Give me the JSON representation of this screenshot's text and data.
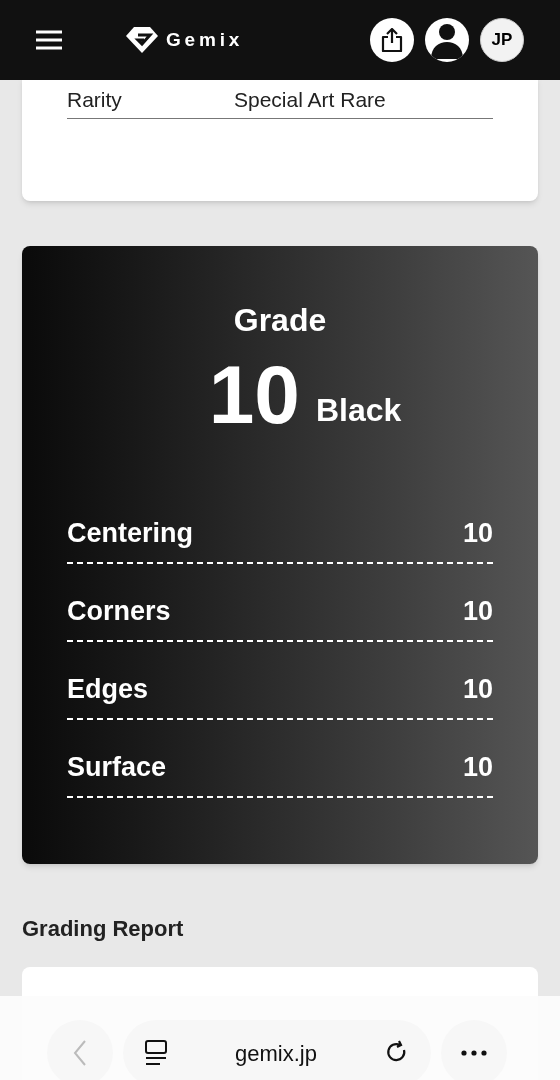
{
  "header": {
    "logo_text": "Gemix",
    "language": "JP"
  },
  "info_rows": [
    {
      "label": "Rarity",
      "value": "Special Art Rare"
    }
  ],
  "grade": {
    "title": "Grade",
    "score": "10",
    "tier": "Black",
    "subgrades": [
      {
        "label": "Centering",
        "value": "10"
      },
      {
        "label": "Corners",
        "value": "10"
      },
      {
        "label": "Edges",
        "value": "10"
      },
      {
        "label": "Surface",
        "value": "10"
      }
    ]
  },
  "report": {
    "title": "Grading Report"
  },
  "browser_bar": {
    "url": "gemix.jp"
  }
}
